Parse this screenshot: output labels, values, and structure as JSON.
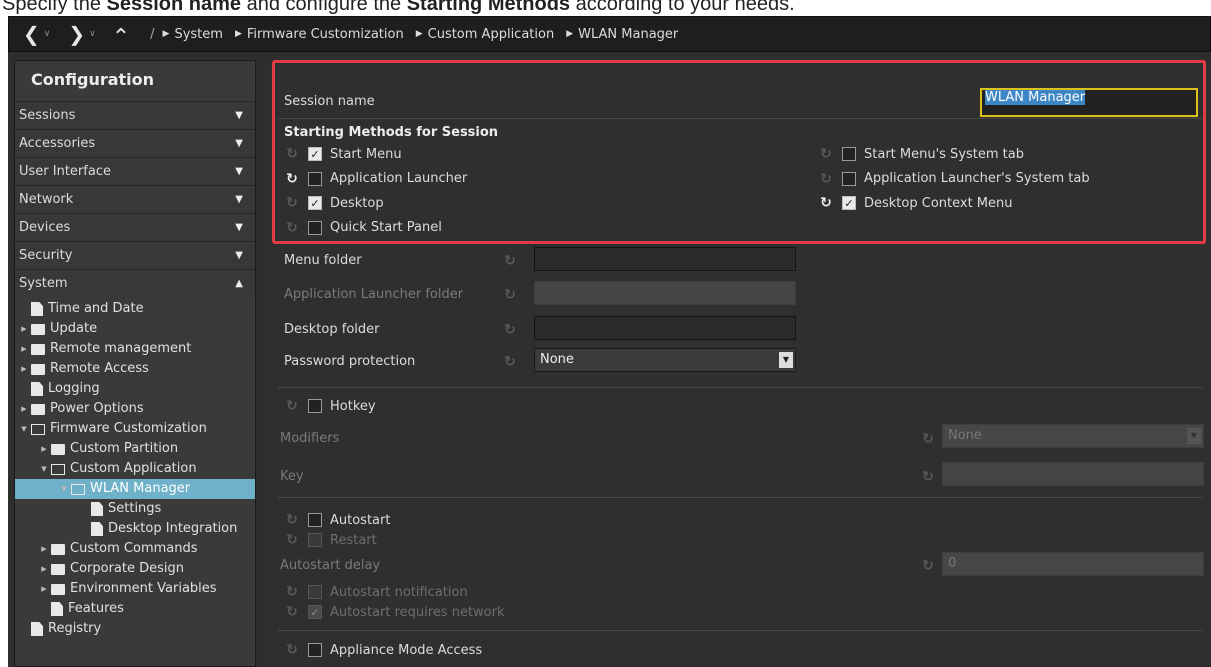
{
  "caption": {
    "prefix": "Specify the ",
    "bold1": "Session name",
    "middle": " and configure the ",
    "bold2": "Starting Methods",
    "suffix": " according to your needs."
  },
  "nav": {
    "back": "❮",
    "forward": "❯",
    "up": "⌃",
    "root_sep": "/",
    "breadcrumbs": [
      "System",
      "Firmware Customization",
      "Custom Application",
      "WLAN Manager"
    ]
  },
  "sidebar": {
    "title": "Configuration",
    "categories": [
      {
        "label": "Sessions",
        "arrow": "▼"
      },
      {
        "label": "Accessories",
        "arrow": "▼"
      },
      {
        "label": "User Interface",
        "arrow": "▼"
      },
      {
        "label": "Network",
        "arrow": "▼"
      },
      {
        "label": "Devices",
        "arrow": "▼"
      },
      {
        "label": "Security",
        "arrow": "▼"
      },
      {
        "label": "System",
        "arrow": "▲"
      }
    ],
    "tree": [
      {
        "label": "Time and Date",
        "icon": "doc",
        "level": 0,
        "exp": ""
      },
      {
        "label": "Update",
        "icon": "folder",
        "level": 0,
        "exp": "▶"
      },
      {
        "label": "Remote management",
        "icon": "folder",
        "level": 0,
        "exp": "▶"
      },
      {
        "label": "Remote Access",
        "icon": "folder",
        "level": 0,
        "exp": "▶"
      },
      {
        "label": "Logging",
        "icon": "doc",
        "level": 0,
        "exp": ""
      },
      {
        "label": "Power Options",
        "icon": "folder",
        "level": 0,
        "exp": "▶"
      },
      {
        "label": "Firmware Customization",
        "icon": "folder-open",
        "level": 0,
        "exp": "▼"
      },
      {
        "label": "Custom Partition",
        "icon": "folder",
        "level": 1,
        "exp": "▶"
      },
      {
        "label": "Custom Application",
        "icon": "folder-open",
        "level": 1,
        "exp": "▼"
      },
      {
        "label": "WLAN Manager",
        "icon": "folder-open",
        "level": 2,
        "exp": "▼",
        "selected": true
      },
      {
        "label": "Settings",
        "icon": "doc",
        "level": 3,
        "exp": ""
      },
      {
        "label": "Desktop Integration",
        "icon": "doc",
        "level": 3,
        "exp": ""
      },
      {
        "label": "Custom Commands",
        "icon": "folder",
        "level": 1,
        "exp": "▶"
      },
      {
        "label": "Corporate Design",
        "icon": "folder",
        "level": 1,
        "exp": "▶"
      },
      {
        "label": "Environment Variables",
        "icon": "folder",
        "level": 1,
        "exp": "▶"
      },
      {
        "label": "Features",
        "icon": "doc",
        "level": 1,
        "exp": ""
      },
      {
        "label": "Registry",
        "icon": "doc",
        "level": 0,
        "exp": ""
      }
    ]
  },
  "main": {
    "session_name_label": "Session name",
    "session_name_value": "WLAN Manager",
    "starting_methods_title": "Starting Methods for Session",
    "methods_left": [
      {
        "label": "Start Menu",
        "checked": true,
        "reset_active": false
      },
      {
        "label": "Application Launcher",
        "checked": false,
        "reset_active": true
      },
      {
        "label": "Desktop",
        "checked": true,
        "reset_active": false
      },
      {
        "label": "Quick Start Panel",
        "checked": false,
        "reset_active": false
      }
    ],
    "methods_right": [
      {
        "label": "Start Menu's System tab",
        "checked": false,
        "reset_active": false
      },
      {
        "label": "Application Launcher's System tab",
        "checked": false,
        "reset_active": false
      },
      {
        "label": "Desktop Context Menu",
        "checked": true,
        "reset_active": true
      }
    ],
    "menu_folder_label": "Menu folder",
    "app_launcher_folder_label": "Application Launcher folder",
    "desktop_folder_label": "Desktop folder",
    "password_protection_label": "Password protection",
    "password_protection_value": "None",
    "hotkey_label": "Hotkey",
    "modifiers_label": "Modifiers",
    "modifiers_value": "None",
    "key_label": "Key",
    "autostart_label": "Autostart",
    "restart_label": "Restart",
    "autostart_delay_label": "Autostart delay",
    "autostart_delay_value": "0",
    "autostart_notification_label": "Autostart notification",
    "autostart_requires_network_label": "Autostart requires network",
    "appliance_mode_label": "Appliance Mode Access"
  }
}
